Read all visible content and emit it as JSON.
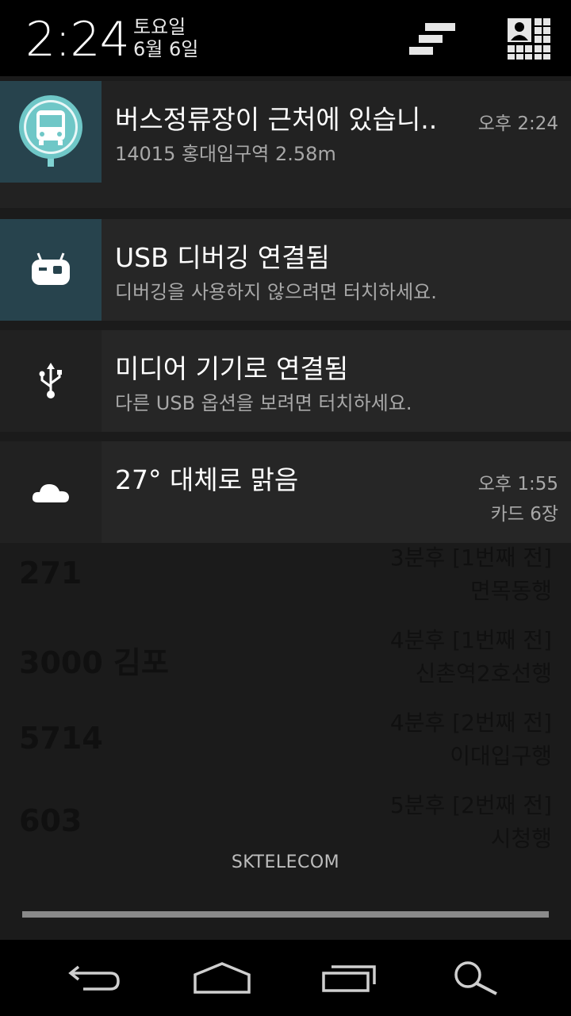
{
  "status": {
    "time": "2:24",
    "day_of_week": "토요일",
    "date": "6월 6일",
    "settings_icon": "settings-sliders-icon",
    "quick_settings_icon": "quick-settings-user-icon"
  },
  "notifications": [
    {
      "app_icon": "bus-stop-icon",
      "title": "버스정류장이 근처에 있습니..",
      "text": "14015 홍대입구역 2.58m",
      "time": "오후 2:24",
      "accent": "#27434d"
    },
    {
      "app_icon": "cyanogenmod-android-icon",
      "title": "USB 디버깅 연결됨",
      "text": "디버깅을 사용하지 않으려면 터치하세요."
    },
    {
      "app_icon": "usb-icon",
      "title": "미디어 기기로 연결됨",
      "text": "다른 USB 옵션을 보려면 터치하세요."
    },
    {
      "app_icon": "cloud-icon",
      "title": "27° 대체로 맑음",
      "time": "오후 1:55",
      "info": "카드 6장"
    }
  ],
  "background_list": [
    {
      "number": "271",
      "eta": "3분후 [1번째 전]",
      "direction": "면목동행"
    },
    {
      "number": "3000 김포",
      "eta": "4분후 [1번째 전]",
      "direction": "신촌역2호선행"
    },
    {
      "number": "5714",
      "eta": "4분후 [2번째 전]",
      "direction": "이대입구행"
    },
    {
      "number": "603",
      "eta": "5분후 [2번째 전]",
      "direction": "시청행"
    }
  ],
  "carrier": "SKTELECOM",
  "navbar": {
    "back_icon": "back-icon",
    "home_icon": "home-icon",
    "recents_icon": "recents-icon",
    "search_icon": "search-icon"
  }
}
